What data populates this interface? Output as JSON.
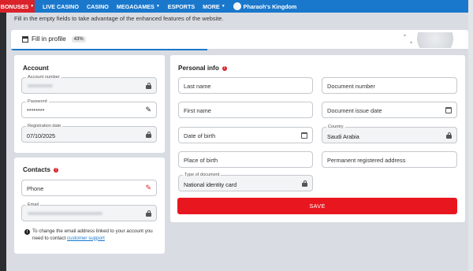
{
  "nav": {
    "bonuses": "BONUSES",
    "items": [
      "LIVE CASINO",
      "CASINO",
      "MEGAGAMES",
      "ESPORTS",
      "MORE"
    ],
    "featured": "Pharaoh's Kingdom"
  },
  "hint": "Fill in the empty fields to take advantage of the enhanced features of the website.",
  "profile": {
    "title": "Fill in profile",
    "percent_label": "43%",
    "percent": 43
  },
  "account": {
    "title": "Account",
    "account_number_label": "Account number",
    "password_label": "Password",
    "password_value": "********",
    "reg_date_label": "Registration date",
    "reg_date_value": "07/10/2025"
  },
  "contacts": {
    "title": "Contacts",
    "phone_placeholder": "Phone",
    "email_label": "Email",
    "note_text": "To change the email address linked to your account you need to contact ",
    "note_link": "customer support"
  },
  "personal": {
    "title": "Personal info",
    "last_name": "Last name",
    "first_name": "First name",
    "date_of_birth": "Date of birth",
    "place_of_birth": "Place of birth",
    "doc_type_label": "Type of document",
    "doc_type_value": "National identity card",
    "doc_number": "Document number",
    "doc_issue_date": "Document issue date",
    "country_label": "Country",
    "country_value": "Saudi Arabia",
    "permanent_address": "Permanent registered address",
    "save": "SAVE"
  },
  "colors": {
    "nav_blue": "#1a78cc",
    "accent_red": "#e8171f"
  }
}
